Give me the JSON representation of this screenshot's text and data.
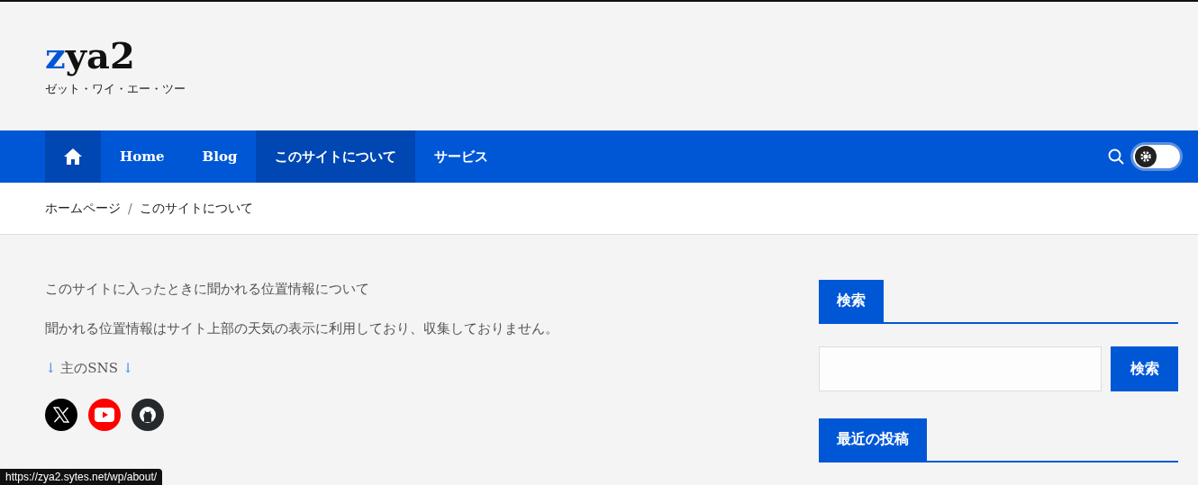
{
  "site": {
    "logo_accent": "z",
    "logo_rest": "ya2",
    "tagline": "ゼット・ワイ・エー・ツー"
  },
  "nav": {
    "items": [
      {
        "kind": "home"
      },
      {
        "kind": "text",
        "label": "Home",
        "selected": false
      },
      {
        "kind": "text",
        "label": "Blog",
        "selected": false
      },
      {
        "kind": "text",
        "label": "このサイトについて",
        "selected": true
      },
      {
        "kind": "text",
        "label": "サービス",
        "selected": false
      }
    ],
    "dark_mode": {
      "on": false
    }
  },
  "breadcrumb": {
    "separator": "/",
    "items": [
      "ホームページ",
      "このサイトについて"
    ]
  },
  "content": {
    "paragraphs": [
      "このサイトに入ったときに聞かれる位置情報について",
      "聞かれる位置情報はサイト上部の天気の表示に利用しており、収集しておりません。"
    ],
    "sns_heading": {
      "arrow_left": "↓",
      "text": " 主のSNS ",
      "arrow_right": "↓"
    },
    "social": [
      {
        "kind": "x",
        "color": "#000000"
      },
      {
        "kind": "youtube",
        "color": "#ff0000"
      },
      {
        "kind": "github",
        "color": "#24292e"
      }
    ]
  },
  "sidebar": {
    "search_title": "検索",
    "search_button": "検索",
    "recent_title": "最近の投稿"
  },
  "status_bar": "https://zya2.sytes.net/wp/about/"
}
